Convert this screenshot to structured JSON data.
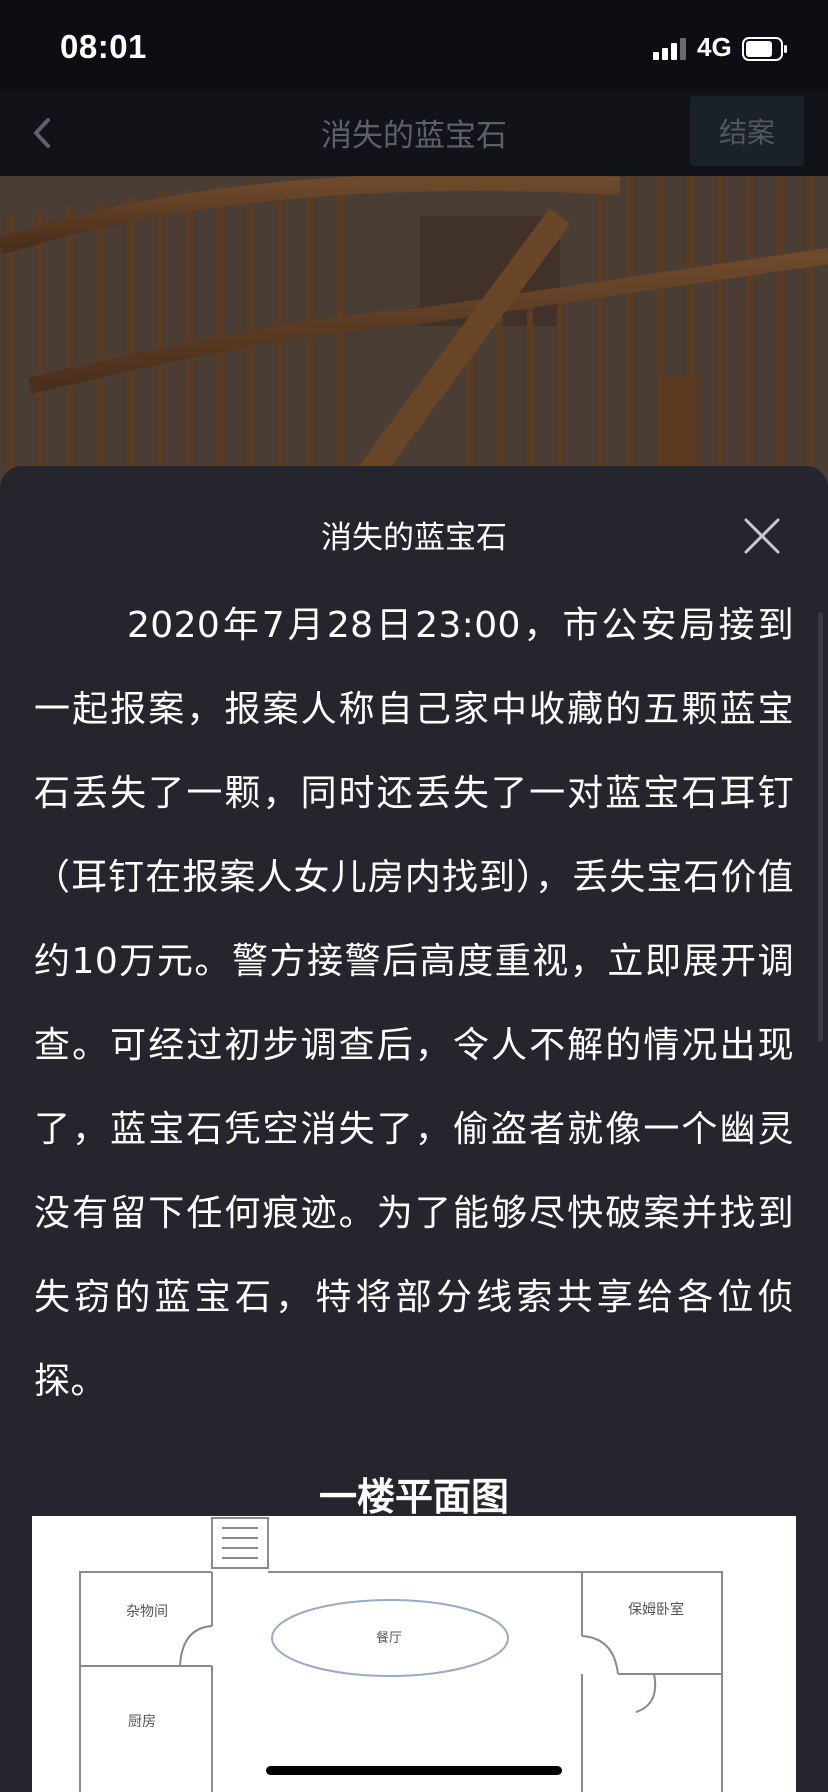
{
  "status_bar": {
    "time": "08:01",
    "network": "4G"
  },
  "nav": {
    "title": "消失的蓝宝石",
    "close_case_label": "结案"
  },
  "sheet": {
    "title": "消失的蓝宝石",
    "story": "2020年7月28日23:00，市公安局接到一起报案，报案人称自己家中收藏的五颗蓝宝石丢失了一颗，同时还丢失了一对蓝宝石耳钉（耳钉在报案人女儿房内找到），丢失宝石价值约10万元。警方接警后高度重视，立即展开调查。可经过初步调查后，令人不解的情况出现了，蓝宝石凭空消失了，偷盗者就像一个幽灵没有留下任何痕迹。为了能够尽快破案并找到失窃的蓝宝石，特将部分线索共享给各位侦探。",
    "floorplan_heading": "一楼平面图",
    "floorplan": {
      "rooms": {
        "storage": "杂物间",
        "dining": "餐厅",
        "nanny": "保姆卧室",
        "other": "厨房"
      }
    }
  }
}
